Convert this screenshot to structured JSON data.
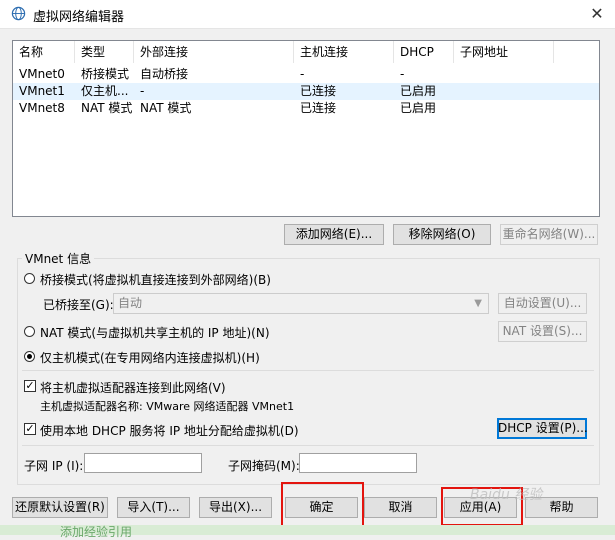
{
  "window": {
    "title": "虚拟网络编辑器",
    "close_glyph": "✕"
  },
  "table": {
    "columns": [
      "名称",
      "类型",
      "外部连接",
      "主机连接",
      "DHCP",
      "子网地址"
    ],
    "rows": [
      {
        "name": "VMnet0",
        "type": "桥接模式",
        "external": "自动桥接",
        "host": "-",
        "dhcp": "-",
        "subnet": ""
      },
      {
        "name": "VMnet1",
        "type": "仅主机...",
        "external": "-",
        "host": "已连接",
        "dhcp": "已启用",
        "subnet": ""
      },
      {
        "name": "VMnet8",
        "type": "NAT 模式",
        "external": "NAT 模式",
        "host": "已连接",
        "dhcp": "已启用",
        "subnet": ""
      }
    ]
  },
  "list_buttons": {
    "add": "添加网络(E)...",
    "remove": "移除网络(O)",
    "rename": "重命名网络(W)..."
  },
  "vmnet_info": {
    "group_label": "VMnet 信息",
    "bridged_label": "桥接模式(将虚拟机直接连接到外部网络)(B)",
    "bridged_to_label": "已桥接至(G):",
    "bridged_to_value": "自动",
    "auto_settings": "自动设置(U)...",
    "nat_label": "NAT 模式(与虚拟机共享主机的 IP 地址)(N)",
    "nat_settings": "NAT 设置(S)...",
    "hostonly_label": "仅主机模式(在专用网络内连接虚拟机)(H)",
    "connect_adapter_label": "将主机虚拟适配器连接到此网络(V)",
    "adapter_name_label": "主机虚拟适配器名称: VMware 网络适配器 VMnet1",
    "dhcp_label": "使用本地 DHCP 服务将 IP 地址分配给虚拟机(D)",
    "dhcp_settings": "DHCP 设置(P)...",
    "subnet_ip_label": "子网 IP (I):",
    "subnet_mask_label": "子网掩码(M):",
    "subnet_ip_value": "",
    "subnet_mask_value": "",
    "selected_mode": "hostonly",
    "check_mark": "✓"
  },
  "footer": {
    "restore": "还原默认设置(R)",
    "import": "导入(T)...",
    "export": "导出(X)...",
    "ok": "确定",
    "cancel": "取消",
    "apply": "应用(A)",
    "help": "帮助"
  },
  "overlay": {
    "watermark": "Baidu 经验",
    "bottom_text": "添加经验引用"
  },
  "colors": {
    "highlight": "#e3140e",
    "selected_row": "#e5f3ff",
    "focus_border": "#0078d7"
  }
}
